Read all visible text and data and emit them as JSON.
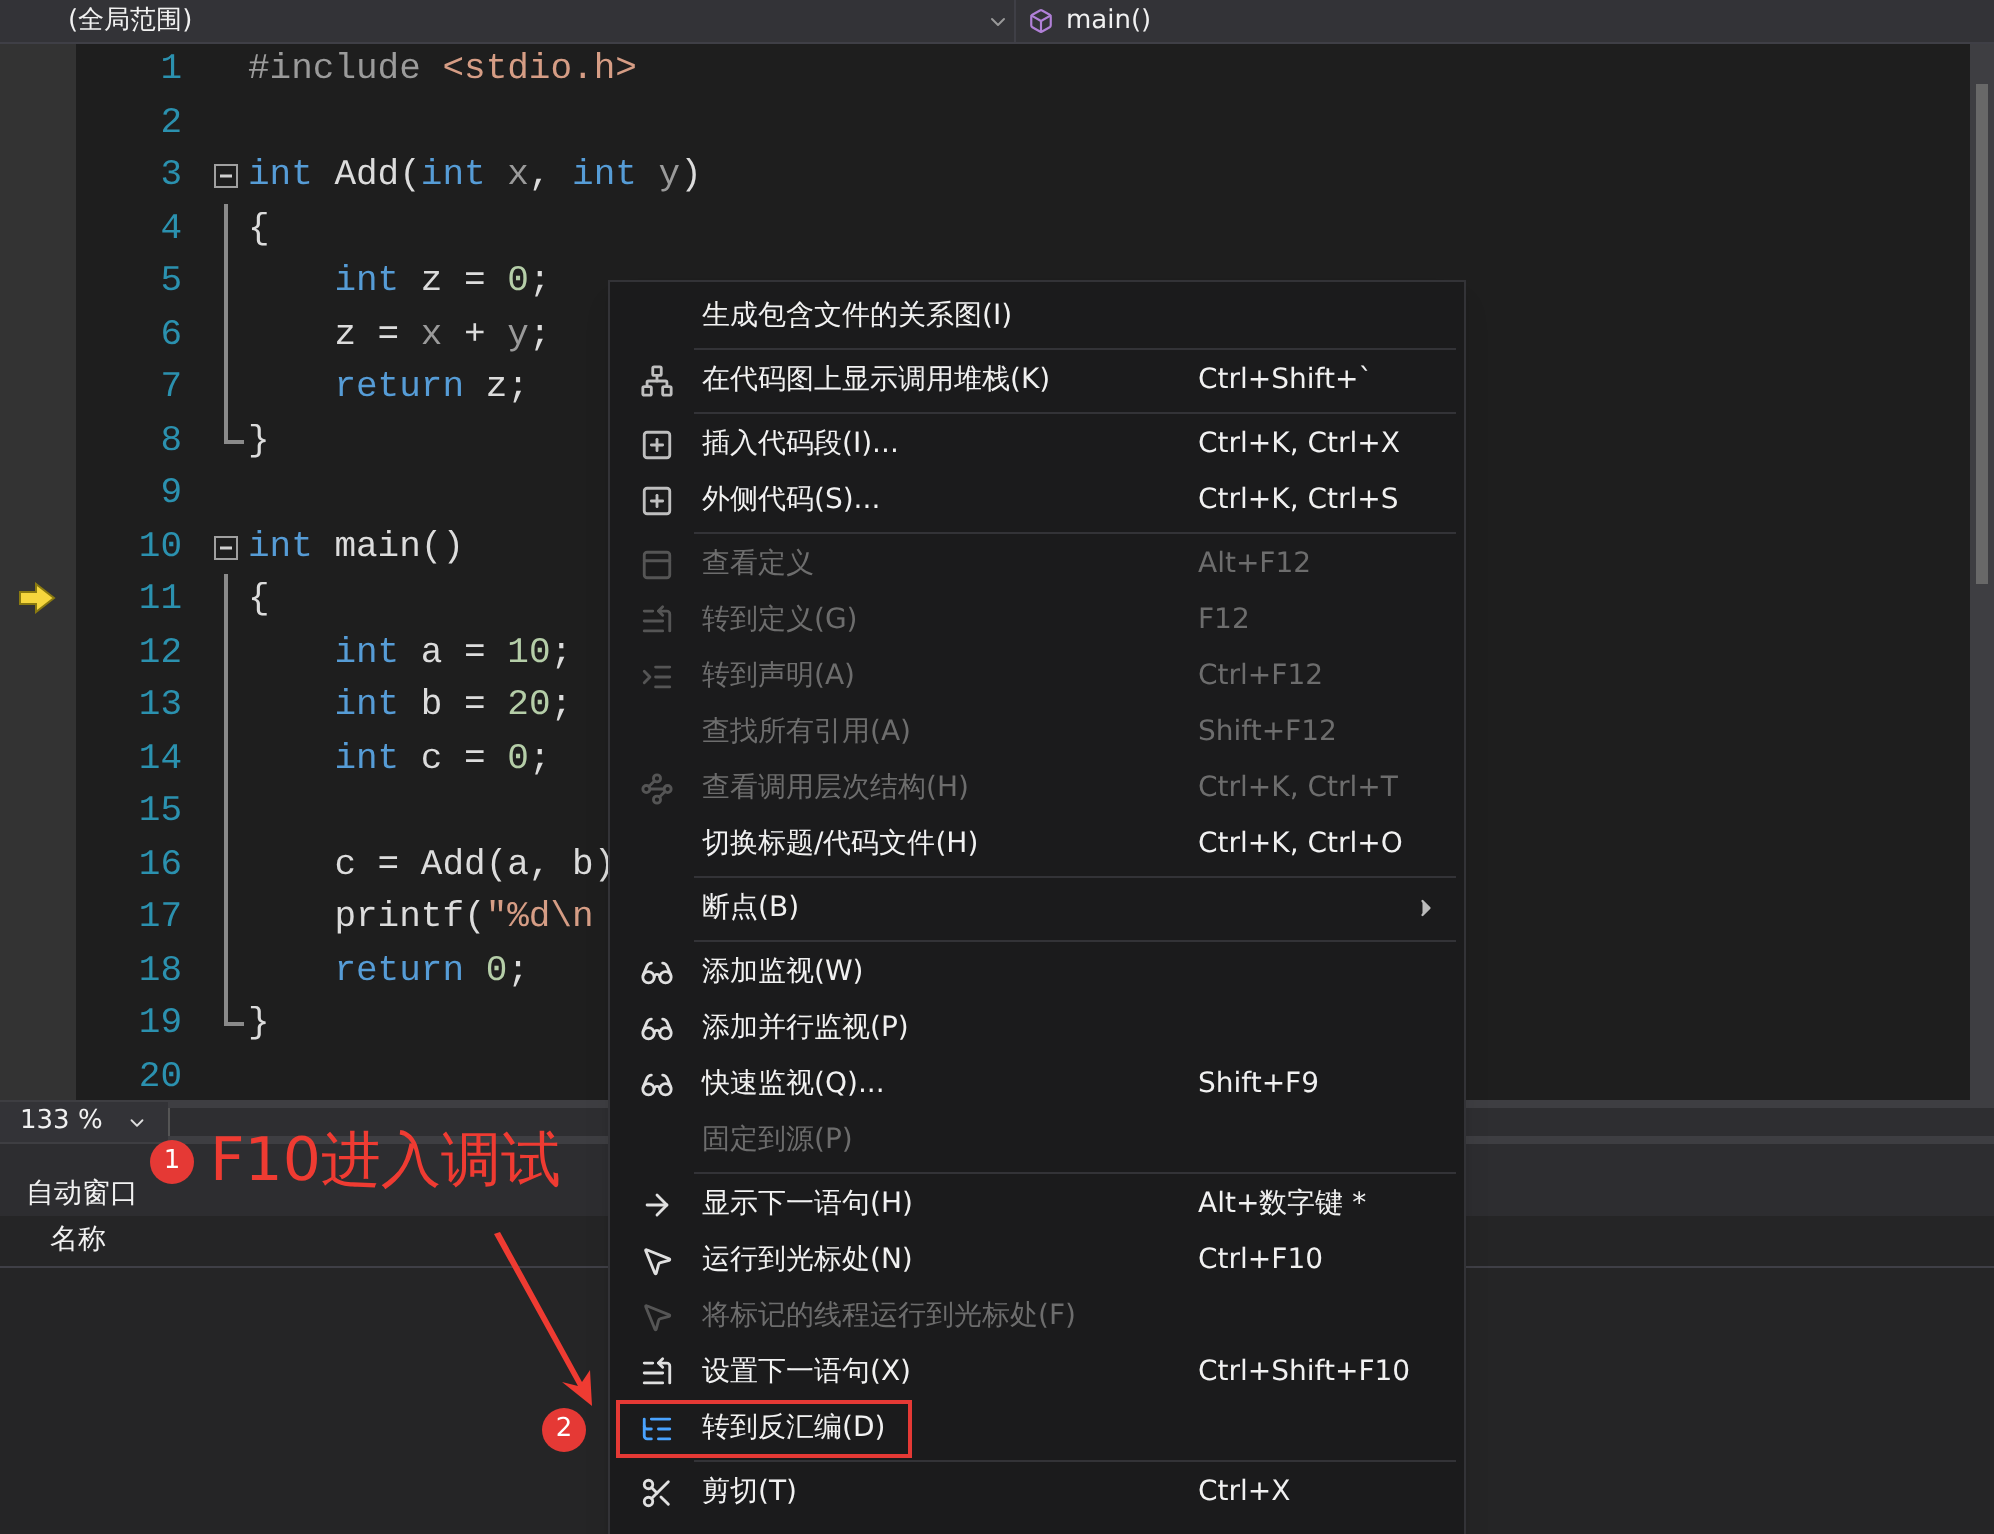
{
  "navbar": {
    "scope": "(全局范围)",
    "member": "main()"
  },
  "code": [
    {
      "number": "1",
      "kind": "plain",
      "current": false,
      "tokens": [
        {
          "kind": "pre",
          "text": "#include "
        },
        {
          "kind": "str",
          "text": "<stdio.h>"
        }
      ]
    },
    {
      "number": "2",
      "kind": "plain",
      "current": false
    },
    {
      "number": "3",
      "kind": "fold_start",
      "current": false,
      "tokens": [
        {
          "kind": "kw",
          "text": "int"
        },
        {
          "kind": "txt",
          "text": " Add("
        },
        {
          "kind": "kw",
          "text": "int"
        },
        {
          "kind": "param",
          "text": " x"
        },
        {
          "kind": "txt",
          "text": ", "
        },
        {
          "kind": "kw",
          "text": "int"
        },
        {
          "kind": "param",
          "text": " y"
        },
        {
          "kind": "txt",
          "text": ")"
        }
      ]
    },
    {
      "number": "4",
      "kind": "fold_body",
      "current": false,
      "tokens": [
        {
          "kind": "txt",
          "text": "{"
        }
      ]
    },
    {
      "number": "5",
      "kind": "fold_body",
      "current": false,
      "tokens": [
        {
          "kind": "kw",
          "text": "    int"
        },
        {
          "kind": "txt",
          "text": " z = "
        },
        {
          "kind": "num",
          "text": "0"
        },
        {
          "kind": "txt",
          "text": ";"
        }
      ]
    },
    {
      "number": "6",
      "kind": "fold_body",
      "current": false,
      "tokens": [
        {
          "kind": "txt",
          "text": "    z = "
        },
        {
          "kind": "param",
          "text": "x"
        },
        {
          "kind": "txt",
          "text": " + "
        },
        {
          "kind": "param",
          "text": "y"
        },
        {
          "kind": "txt",
          "text": ";"
        }
      ]
    },
    {
      "number": "7",
      "kind": "fold_body",
      "current": false,
      "tokens": [
        {
          "kind": "kw",
          "text": "    return"
        },
        {
          "kind": "txt",
          "text": " z;"
        }
      ]
    },
    {
      "number": "8",
      "kind": "fold_end",
      "current": false,
      "tokens": [
        {
          "kind": "txt",
          "text": "}"
        }
      ]
    },
    {
      "number": "9",
      "kind": "plain",
      "current": false
    },
    {
      "number": "10",
      "kind": "fold_start",
      "current": false,
      "tokens": [
        {
          "kind": "kw",
          "text": "int"
        },
        {
          "kind": "txt",
          "text": " main()"
        }
      ]
    },
    {
      "number": "11",
      "kind": "fold_body",
      "current": true,
      "tokens": [
        {
          "kind": "txt",
          "text": "{"
        }
      ]
    },
    {
      "number": "12",
      "kind": "fold_body",
      "current": false,
      "tokens": [
        {
          "kind": "kw",
          "text": "    int"
        },
        {
          "kind": "txt",
          "text": " a = "
        },
        {
          "kind": "num",
          "text": "10"
        },
        {
          "kind": "txt",
          "text": ";"
        }
      ]
    },
    {
      "number": "13",
      "kind": "fold_body",
      "current": false,
      "tokens": [
        {
          "kind": "kw",
          "text": "    int"
        },
        {
          "kind": "txt",
          "text": " b = "
        },
        {
          "kind": "num",
          "text": "20"
        },
        {
          "kind": "txt",
          "text": ";"
        }
      ]
    },
    {
      "number": "14",
      "kind": "fold_body",
      "current": false,
      "tokens": [
        {
          "kind": "kw",
          "text": "    int"
        },
        {
          "kind": "txt",
          "text": " c = "
        },
        {
          "kind": "num",
          "text": "0"
        },
        {
          "kind": "txt",
          "text": ";"
        }
      ]
    },
    {
      "number": "15",
      "kind": "fold_body",
      "current": false
    },
    {
      "number": "16",
      "kind": "fold_body",
      "current": false,
      "tokens": [
        {
          "kind": "txt",
          "text": "    c = Add(a, b)"
        }
      ]
    },
    {
      "number": "17",
      "kind": "fold_body",
      "current": false,
      "tokens": [
        {
          "kind": "txt",
          "text": "    printf("
        },
        {
          "kind": "str",
          "text": "\"%d\\n"
        }
      ]
    },
    {
      "number": "18",
      "kind": "fold_body",
      "current": false,
      "tokens": [
        {
          "kind": "kw",
          "text": "    return"
        },
        {
          "kind": "num",
          "text": " 0"
        },
        {
          "kind": "txt",
          "text": ";"
        }
      ]
    },
    {
      "number": "19",
      "kind": "fold_end",
      "current": false,
      "tokens": [
        {
          "kind": "txt",
          "text": "}"
        }
      ]
    },
    {
      "number": "20",
      "kind": "plain",
      "current": false
    }
  ],
  "zoom": "133 %",
  "autos_panel": {
    "title": "自动窗口",
    "columns": [
      "名称"
    ]
  },
  "context_menu": [
    {
      "kind": "item",
      "label": "生成包含文件的关系图(I)",
      "disabled": false,
      "boxed": false
    },
    {
      "kind": "separator"
    },
    {
      "kind": "item",
      "label": "在代码图上显示调用堆栈(K)",
      "shortcut": "Ctrl+Shift+`",
      "disabled": false,
      "boxed": false
    },
    {
      "kind": "separator"
    },
    {
      "kind": "item",
      "label": "插入代码段(I)...",
      "shortcut": "Ctrl+K, Ctrl+X",
      "disabled": false,
      "boxed": false
    },
    {
      "kind": "item",
      "label": "外侧代码(S)...",
      "shortcut": "Ctrl+K, Ctrl+S",
      "disabled": false,
      "boxed": false
    },
    {
      "kind": "separator"
    },
    {
      "kind": "item",
      "label": "查看定义",
      "shortcut": "Alt+F12",
      "disabled": true,
      "boxed": false
    },
    {
      "kind": "item",
      "label": "转到定义(G)",
      "shortcut": "F12",
      "disabled": true,
      "boxed": false
    },
    {
      "kind": "item",
      "label": "转到声明(A)",
      "shortcut": "Ctrl+F12",
      "disabled": true,
      "boxed": false
    },
    {
      "kind": "item",
      "label": "查找所有引用(A)",
      "shortcut": "Shift+F12",
      "disabled": true,
      "boxed": false
    },
    {
      "kind": "item",
      "label": "查看调用层次结构(H)",
      "shortcut": "Ctrl+K, Ctrl+T",
      "disabled": true,
      "boxed": false
    },
    {
      "kind": "item",
      "label": "切换标题/代码文件(H)",
      "shortcut": "Ctrl+K, Ctrl+O",
      "disabled": false,
      "boxed": false
    },
    {
      "kind": "separator"
    },
    {
      "kind": "submenu",
      "label": "断点(B)",
      "disabled": false,
      "boxed": false
    },
    {
      "kind": "separator"
    },
    {
      "kind": "item",
      "label": "添加监视(W)",
      "disabled": false,
      "boxed": false
    },
    {
      "kind": "item",
      "label": "添加并行监视(P)",
      "disabled": false,
      "boxed": false
    },
    {
      "kind": "item",
      "label": "快速监视(Q)...",
      "shortcut": "Shift+F9",
      "disabled": false,
      "boxed": false
    },
    {
      "kind": "item",
      "label": "固定到源(P)",
      "disabled": true,
      "boxed": false
    },
    {
      "kind": "separator"
    },
    {
      "kind": "item",
      "label": "显示下一语句(H)",
      "shortcut": "Alt+数字键 *",
      "disabled": false,
      "boxed": false
    },
    {
      "kind": "item",
      "label": "运行到光标处(N)",
      "shortcut": "Ctrl+F10",
      "disabled": false,
      "boxed": false
    },
    {
      "kind": "item",
      "label": "将标记的线程运行到光标处(F)",
      "disabled": true,
      "boxed": false
    },
    {
      "kind": "item",
      "label": "设置下一语句(X)",
      "shortcut": "Ctrl+Shift+F10",
      "disabled": false,
      "boxed": false
    },
    {
      "kind": "item",
      "label": "转到反汇编(D)",
      "disabled": false,
      "boxed": true
    },
    {
      "kind": "separator"
    },
    {
      "kind": "item",
      "label": "剪切(T)",
      "shortcut": "Ctrl+X",
      "disabled": false,
      "boxed": false
    }
  ],
  "annotations": [
    {
      "number": "1",
      "text": "F10进入调试"
    },
    {
      "number": "2"
    }
  ]
}
